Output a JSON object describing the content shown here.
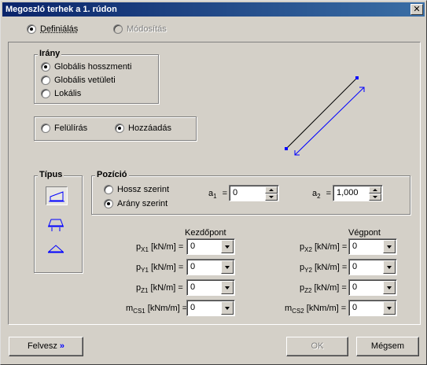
{
  "window": {
    "title": "Megoszló terhek a 1. rúdon",
    "close_label": "✕"
  },
  "mode": {
    "define_label": "Definiálás",
    "modify_label": "Módosítás"
  },
  "direction": {
    "title": "Irány",
    "options": [
      "Globális hosszmenti",
      "Globális vetületi",
      "Lokális"
    ]
  },
  "combine": {
    "overwrite_label": "Felülírás",
    "add_label": "Hozzáadás"
  },
  "type": {
    "title": "Típus"
  },
  "position": {
    "title": "Pozíció",
    "by_length_label": "Hossz szerint",
    "by_ratio_label": "Arány szerint",
    "a1_symbol": "a",
    "a1_sub": "1",
    "a1_value": "0",
    "a2_symbol": "a",
    "a2_sub": "2",
    "a2_value": "1,000"
  },
  "loads": {
    "start_header": "Kezdőpont",
    "end_header": "Végpont",
    "start_rows": [
      {
        "symbol": "p",
        "sub": "X1",
        "unit": "[kN/m] =",
        "value": "0"
      },
      {
        "symbol": "p",
        "sub": "Y1",
        "unit": "[kN/m] =",
        "value": "0"
      },
      {
        "symbol": "p",
        "sub": "Z1",
        "unit": "[kN/m] =",
        "value": "0"
      },
      {
        "symbol": "m",
        "sub": "CS1",
        "unit": "[kNm/m] =",
        "value": "0"
      }
    ],
    "end_rows": [
      {
        "symbol": "p",
        "sub": "X2",
        "unit": "[kN/m] =",
        "value": "0"
      },
      {
        "symbol": "p",
        "sub": "Y2",
        "unit": "[kN/m] =",
        "value": "0"
      },
      {
        "symbol": "p",
        "sub": "Z2",
        "unit": "[kN/m] =",
        "value": "0"
      },
      {
        "symbol": "m",
        "sub": "CS2",
        "unit": "[kNm/m] =",
        "value": "0"
      }
    ]
  },
  "buttons": {
    "felvesz_label": "Felvesz",
    "felvesz_arrows": "»",
    "ok_label": "OK",
    "cancel_label": "Mégsem"
  },
  "colors": {
    "accent_blue": "#0000ff",
    "title_bar": "#0a246a"
  },
  "preview": {
    "description_icon": "bar-with-direction-arrow-icon"
  }
}
